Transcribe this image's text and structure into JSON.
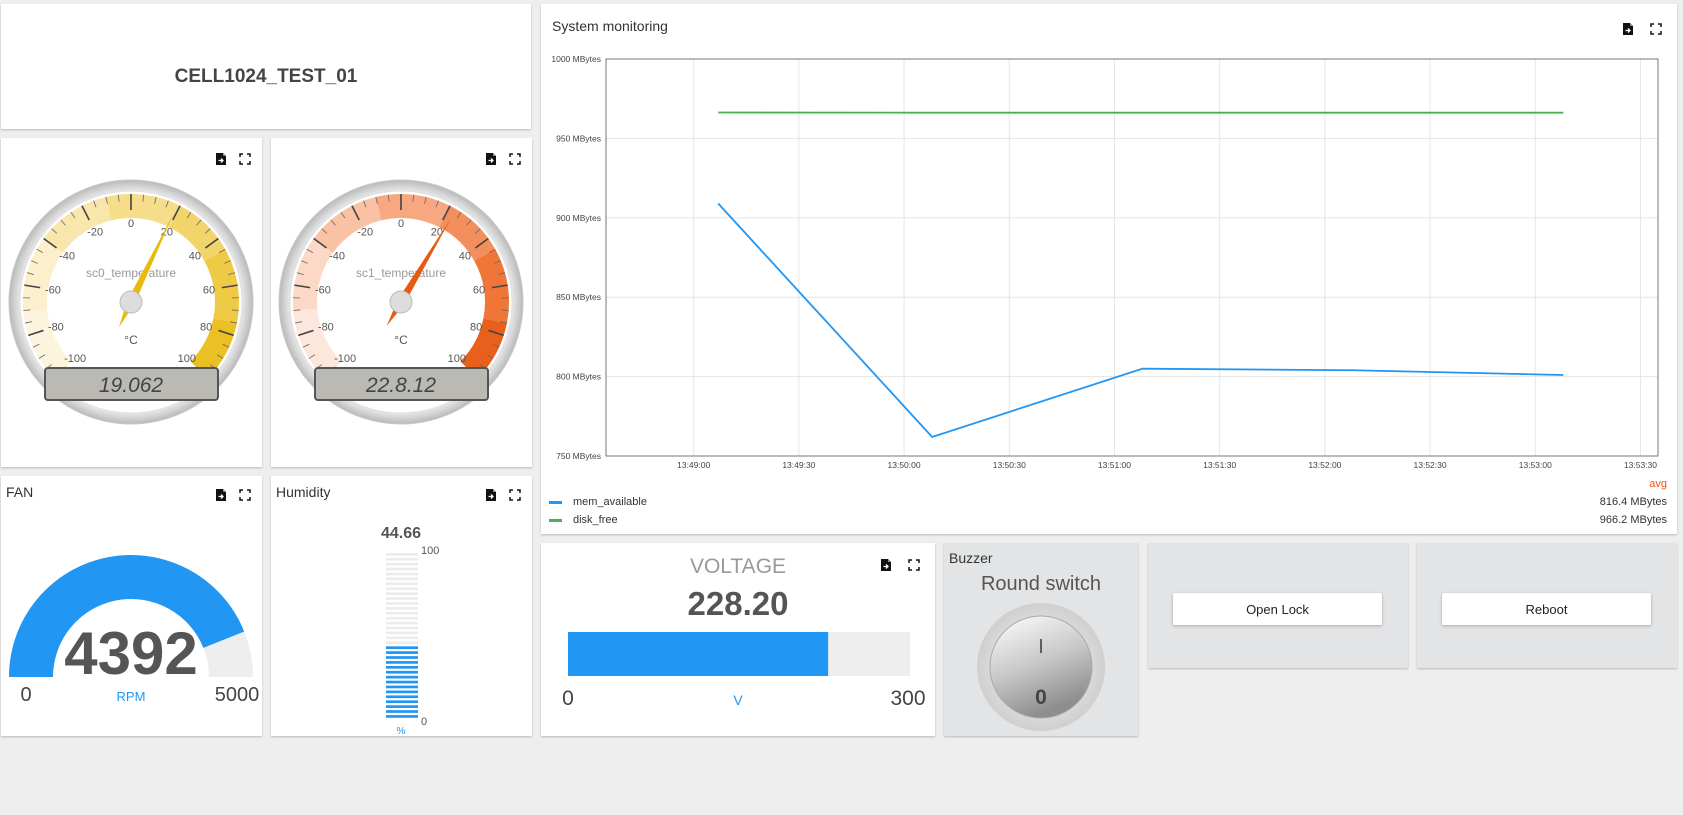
{
  "header": {
    "title": "CELL1024_TEST_01"
  },
  "gauge0": {
    "label": "sc0_temperature",
    "unit": "°C",
    "value": 19.062,
    "display": "19.062",
    "min": -100,
    "max": 100,
    "ticks": [
      "-100",
      "-80",
      "-60",
      "-40",
      "-20",
      "0",
      "20",
      "40",
      "60",
      "80",
      "100"
    ],
    "palette": [
      "#fcf4dc",
      "#fbefcc",
      "#f8e6ac",
      "#f5dd8a",
      "#f2d56a",
      "#efcb45",
      "#ebc025"
    ],
    "needle_color": "#e8b90e"
  },
  "gauge1": {
    "label": "sc1_temperature",
    "unit": "°C",
    "value": 22.812,
    "display": "22.8.12",
    "min": -100,
    "max": 100,
    "ticks": [
      "-100",
      "-80",
      "-60",
      "-40",
      "-20",
      "0",
      "20",
      "40",
      "60",
      "80",
      "100"
    ],
    "palette": [
      "#fde7dc",
      "#fcd8c6",
      "#fac2a4",
      "#f7a880",
      "#f38f5c",
      "#ef7636",
      "#e9601c"
    ],
    "needle_color": "#e65b12"
  },
  "fan": {
    "title": "FAN",
    "value": "4392",
    "value_num": 4392,
    "min": "0",
    "max": "5000",
    "min_num": 0,
    "max_num": 5000,
    "unit": "RPM",
    "color": "#2196f3"
  },
  "humidity": {
    "title": "Humidity",
    "value": "44.66",
    "value_num": 44.66,
    "max": "100",
    "min": "0",
    "unit": "%",
    "color": "#2196f3"
  },
  "system": {
    "title": "System monitoring",
    "avg_label": "avg",
    "legend": [
      {
        "name": "mem_available",
        "color": "#2196f3",
        "avg": "816.4 MBytes"
      },
      {
        "name": "disk_free",
        "color": "#4caf50",
        "avg": "966.2 MBytes"
      }
    ]
  },
  "chart_data": {
    "type": "line",
    "title": "System monitoring",
    "x_ticks": [
      "13:49:00",
      "13:49:30",
      "13:50:00",
      "13:50:30",
      "13:51:00",
      "13:51:30",
      "13:52:00",
      "13:52:30",
      "13:53:00",
      "13:53:30"
    ],
    "y_ticks": [
      "1000 MBytes",
      "950 MBytes",
      "900 MBytes",
      "850 MBytes",
      "800 MBytes",
      "750 MBytes"
    ],
    "xlim": [
      "13:48:35",
      "13:53:35"
    ],
    "ylim": [
      750,
      1000
    ],
    "grid": true,
    "legend_position": "bottom",
    "series": [
      {
        "name": "mem_available",
        "x": [
          "13:49:07",
          "13:50:08",
          "13:51:08",
          "13:52:08",
          "13:53:08"
        ],
        "y": [
          909,
          762,
          805,
          804,
          801
        ]
      },
      {
        "name": "disk_free",
        "x": [
          "13:49:07",
          "13:50:08",
          "13:51:08",
          "13:52:08",
          "13:53:08"
        ],
        "y": [
          966.3,
          966.2,
          966.2,
          966.2,
          966.2
        ]
      }
    ]
  },
  "voltage": {
    "title": "VOLTAGE",
    "value": "228.20",
    "value_num": 228.2,
    "min": "0",
    "max": "300",
    "min_num": 0,
    "max_num": 300,
    "unit": "V",
    "color": "#2196f3"
  },
  "buzzer": {
    "title": "Buzzer",
    "label": "Round switch",
    "on_mark": "I",
    "off_mark": "0"
  },
  "open_lock": {
    "label": "Open Lock"
  },
  "reboot": {
    "label": "Reboot"
  }
}
